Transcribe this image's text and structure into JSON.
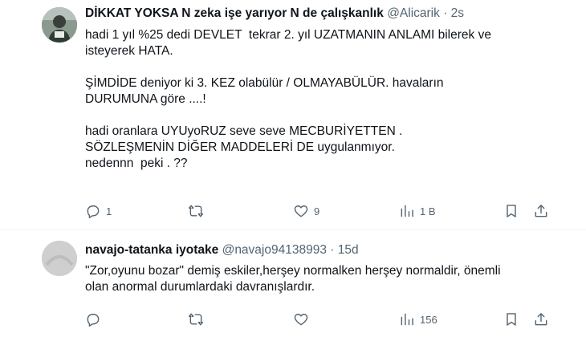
{
  "tweets": [
    {
      "name": "DİKKAT YOKSA N zeka işe yarıyor N de çalışkanlık",
      "handle": "@Alicarik",
      "sep": "·",
      "time": "2s",
      "text": "hadi 1 yıl %25 dedi DEVLET  tekrar 2. yıl UZATMANIN ANLAMI bilerek ve\nisteyerek HATA.\n\nŞİMDİDE deniyor ki 3. KEZ olabülür / OLMAYABÜLÜR. havaların\nDURUMUNA göre ....!\n\nhadi oranlara UYUyoRUZ seve seve MECBURİYETTEN .\nSÖZLEŞMENİN DİĞER MADDELERİ DE uygulanmıyor.\nnedennn  peki . ??",
      "replies": "1",
      "retweets": "",
      "likes": "9",
      "views": "1 B"
    },
    {
      "name": "navajo-tatanka iyotake",
      "handle": "@navajo94138993",
      "sep": "·",
      "time": "15d",
      "text": "\"Zor,oyunu bozar\" demiş eskiler,herşey normalken herşey normaldir, önemli\nolan anormal durumlardaki davranışlardır.",
      "replies": "",
      "retweets": "",
      "likes": "",
      "views": "156"
    }
  ]
}
